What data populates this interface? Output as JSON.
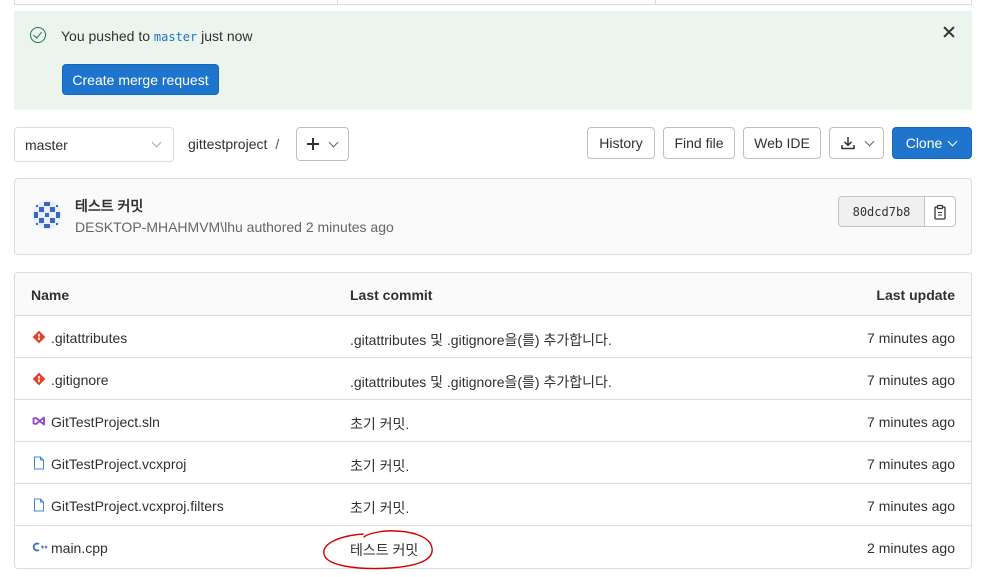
{
  "alert": {
    "message_prefix": "You pushed to",
    "branch": "master",
    "message_suffix": "just now",
    "button": "Create merge request"
  },
  "toolbar": {
    "branch": "master",
    "project": "gittestproject",
    "separator": "/",
    "history": "History",
    "find_file": "Find file",
    "web_ide": "Web IDE",
    "clone": "Clone"
  },
  "commit": {
    "title": "테스트 커밋",
    "meta": "DESKTOP-MHAHMVM\\lhu authored 2 minutes ago",
    "sha": "80dcd7b8"
  },
  "table": {
    "headers": {
      "name": "Name",
      "last_commit": "Last commit",
      "last_update": "Last update"
    },
    "rows": [
      {
        "name": ".gitattributes",
        "commit": ".gitattributes 및 .gitignore을(를) 추가합니다.",
        "updated": "7 minutes ago",
        "icon": "git-icon"
      },
      {
        "name": ".gitignore",
        "commit": ".gitattributes 및 .gitignore을(를) 추가합니다.",
        "updated": "7 minutes ago",
        "icon": "git-icon"
      },
      {
        "name": "GitTestProject.sln",
        "commit": "초기 커밋.",
        "updated": "7 minutes ago",
        "icon": "visual-studio-icon"
      },
      {
        "name": "GitTestProject.vcxproj",
        "commit": "초기 커밋.",
        "updated": "7 minutes ago",
        "icon": "file-icon"
      },
      {
        "name": "GitTestProject.vcxproj.filters",
        "commit": "초기 커밋.",
        "updated": "7 minutes ago",
        "icon": "file-icon"
      },
      {
        "name": "main.cpp",
        "commit": "테스트 커밋",
        "updated": "2 minutes ago",
        "icon": "cpp-icon"
      }
    ]
  },
  "colors": {
    "primary": "#1f75cb",
    "alert_bg": "#ecf4ee",
    "success": "#217645",
    "annotation": "#d40000"
  }
}
